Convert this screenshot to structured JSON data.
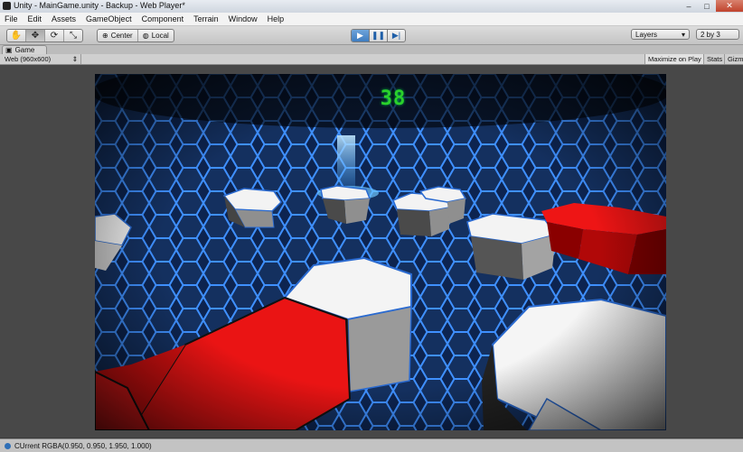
{
  "window": {
    "title": "Unity - MainGame.unity - Backup - Web Player*",
    "minimize_glyph": "–",
    "maximize_glyph": "□",
    "close_glyph": "✕"
  },
  "menu": [
    "File",
    "Edit",
    "Assets",
    "GameObject",
    "Component",
    "Terrain",
    "Window",
    "Help"
  ],
  "toolbar": {
    "pivot_center": "Center",
    "pivot_local": "Local",
    "layers": "Layers",
    "layout": "2 by 3",
    "tools": [
      {
        "name": "hand-tool",
        "glyph": "✋"
      },
      {
        "name": "move-tool",
        "glyph": "✥"
      },
      {
        "name": "rotate-tool",
        "glyph": "⟳"
      },
      {
        "name": "scale-tool",
        "glyph": "⤡"
      }
    ],
    "play_glyph": "▶",
    "pause_glyph": "❚❚",
    "step_glyph": "▶|"
  },
  "game_view": {
    "tab_label": "Game",
    "resolution": "Web (960x600)",
    "maximize_on_play": "Maximize on Play",
    "stats": "Stats",
    "gizmos": "Gizm",
    "score": "38"
  },
  "status": {
    "text": "CUrrent RGBA(0.950, 0.950, 1.950, 1.000)"
  },
  "colors": {
    "hex_grid": "#2f7fe0",
    "tile_red": "#e01010",
    "tile_white": "#f2f2f2",
    "timer_green": "#2bd12b"
  }
}
